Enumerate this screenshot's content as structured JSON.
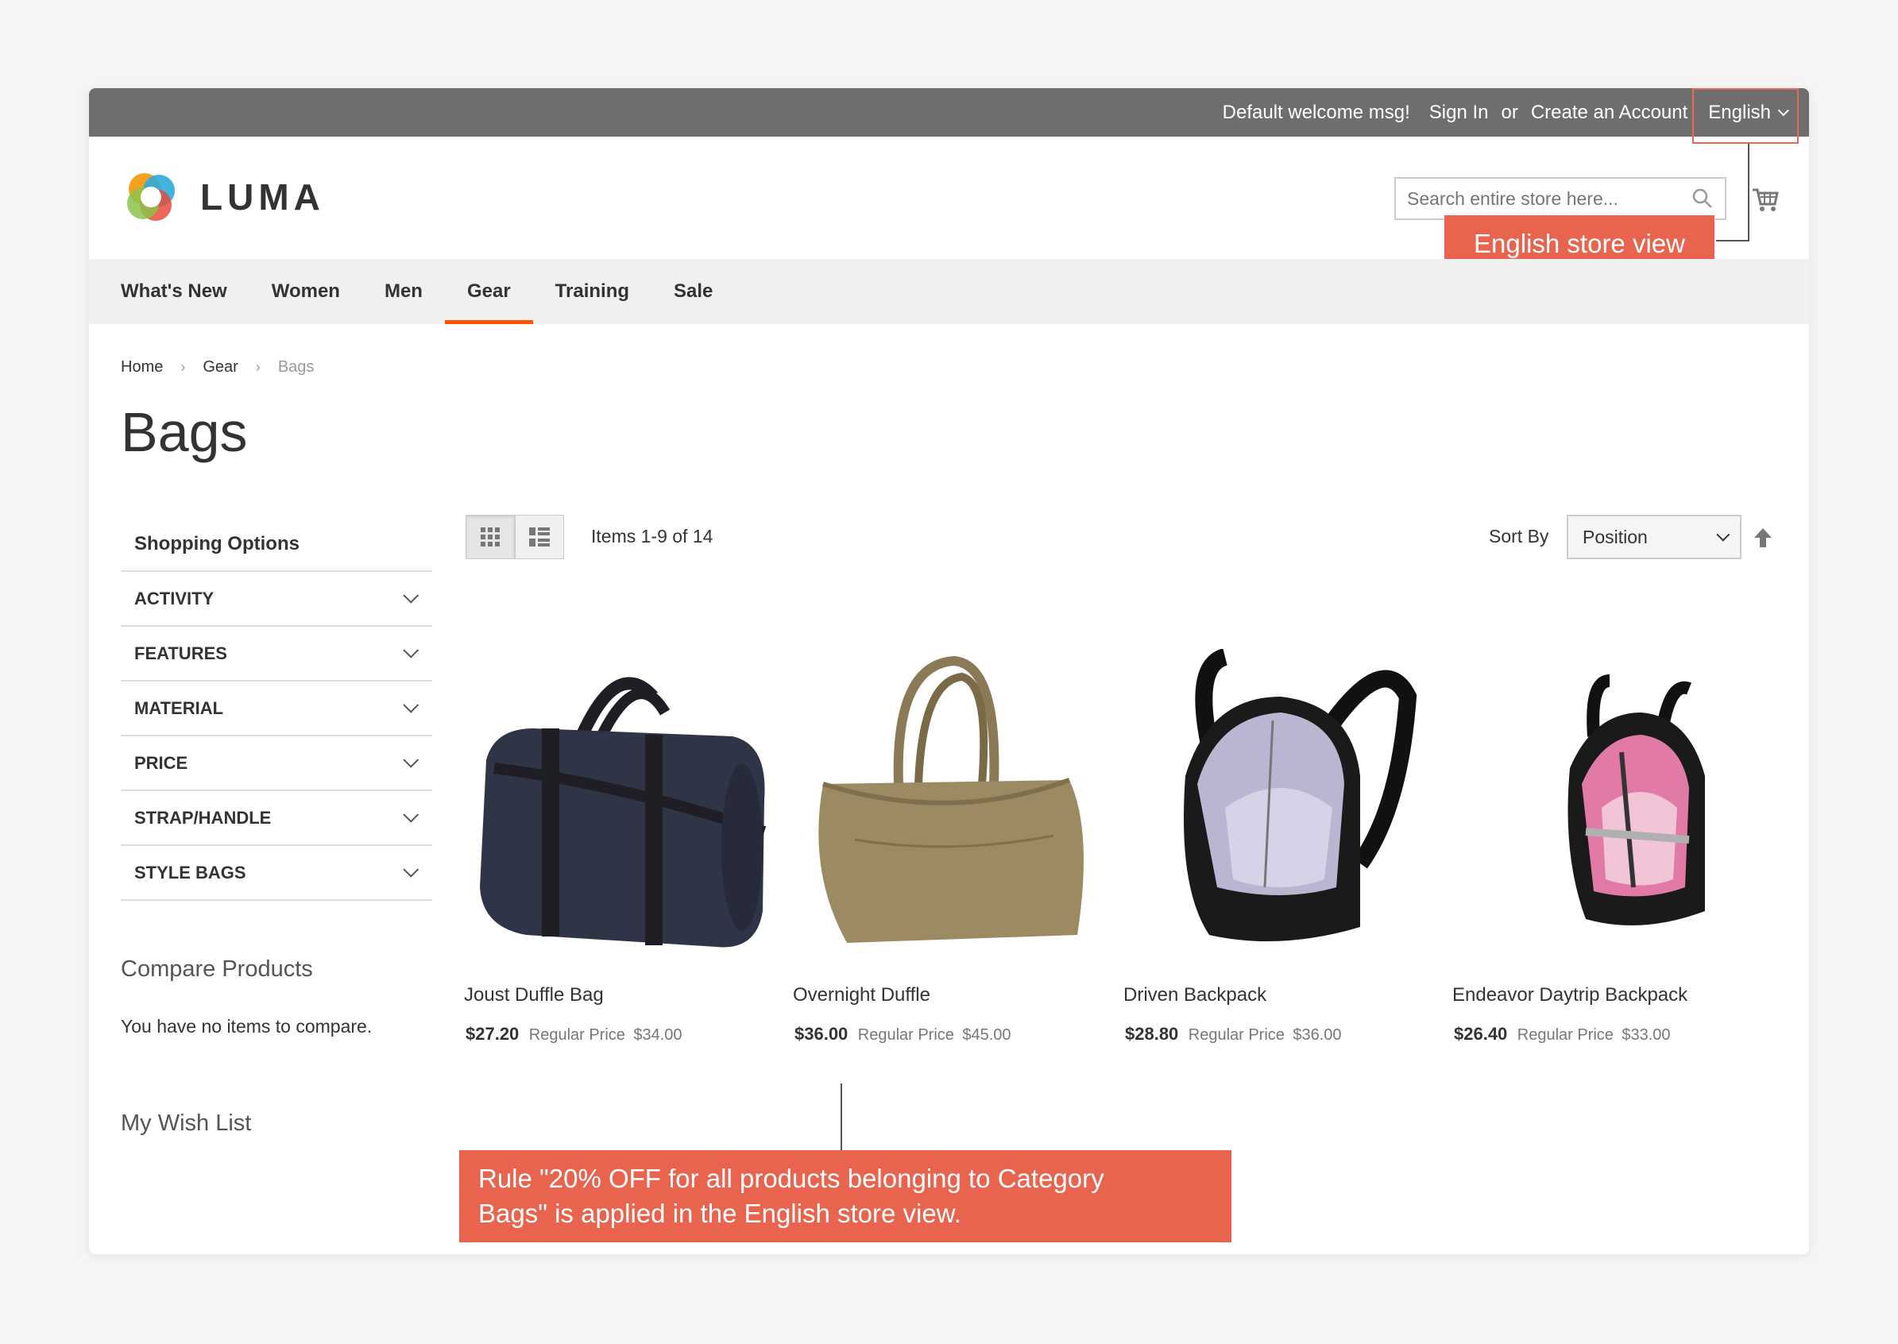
{
  "topbar": {
    "welcome": "Default welcome msg!",
    "sign_in": "Sign In",
    "or": "or",
    "create_account": "Create an Account",
    "language": "English"
  },
  "header": {
    "logo_text": "LUMA",
    "search_placeholder": "Search entire store here..."
  },
  "annotations": {
    "store_view": "English store view",
    "rule_line1": "Rule \"20% OFF for all products belonging to Category",
    "rule_line2": "Bags\" is applied in the English store view."
  },
  "nav": {
    "items": [
      {
        "label": "What's New"
      },
      {
        "label": "Women"
      },
      {
        "label": "Men"
      },
      {
        "label": "Gear"
      },
      {
        "label": "Training"
      },
      {
        "label": "Sale"
      }
    ],
    "active": "Gear"
  },
  "breadcrumb": {
    "items": [
      "Home",
      "Gear",
      "Bags"
    ]
  },
  "page": {
    "title": "Bags"
  },
  "sidebar": {
    "shopping_options": "Shopping Options",
    "filters": [
      "ACTIVITY",
      "FEATURES",
      "MATERIAL",
      "PRICE",
      "STRAP/HANDLE",
      "STYLE BAGS"
    ],
    "compare_title": "Compare Products",
    "compare_text": "You have no items to compare.",
    "wishlist_title": "My Wish List"
  },
  "toolbar": {
    "items_count": "Items 1-9 of 14",
    "sort_label": "Sort By",
    "sort_value": "Position"
  },
  "products": [
    {
      "name": "Joust Duffle Bag",
      "price": "$27.20",
      "regular_label": "Regular Price",
      "regular_price": "$34.00"
    },
    {
      "name": "Overnight Duffle",
      "price": "$36.00",
      "regular_label": "Regular Price",
      "regular_price": "$45.00"
    },
    {
      "name": "Driven Backpack",
      "price": "$28.80",
      "regular_label": "Regular Price",
      "regular_price": "$36.00"
    },
    {
      "name": "Endeavor Daytrip Backpack",
      "price": "$26.40",
      "regular_label": "Regular Price",
      "regular_price": "$33.00"
    }
  ],
  "colors": {
    "accent": "#ff5501",
    "callout": "#e8644e",
    "topbar": "#6e6e6e"
  }
}
